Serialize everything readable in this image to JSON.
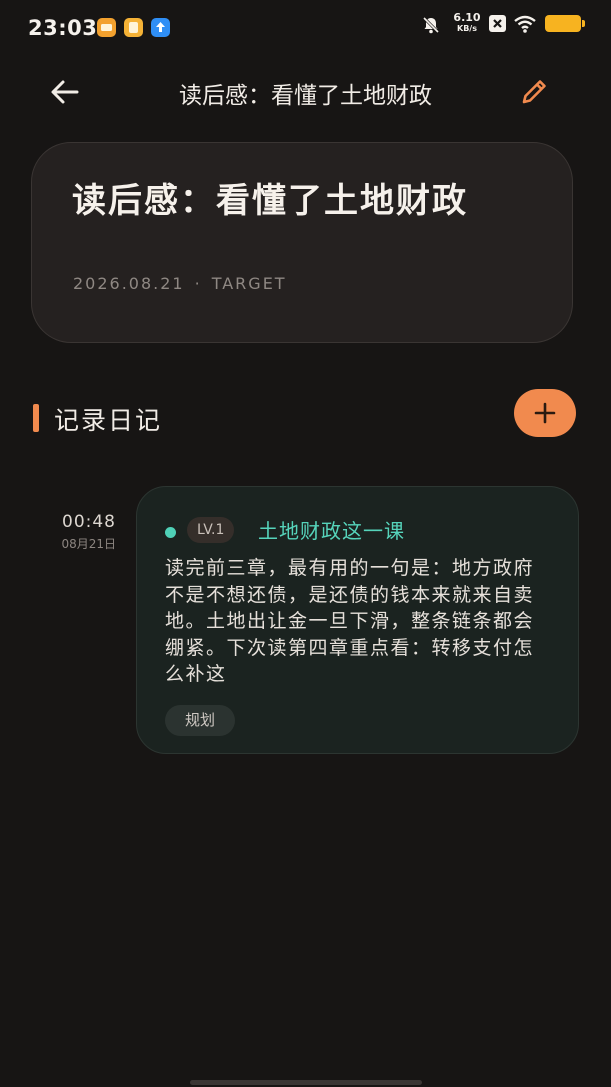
{
  "status_bar": {
    "time": "23:03",
    "net_speed_value": "6.10",
    "net_speed_unit": "KB/s",
    "battery_color": "#f7b320"
  },
  "app_bar": {
    "title": "读后感：看懂了土地财政",
    "back_icon": "arrow-left-icon",
    "edit_icon": "pencil-icon"
  },
  "book": {
    "title": "读后感：看懂了土地财政",
    "date": "2026.08.21",
    "separator": "·",
    "label": "TARGET"
  },
  "section": {
    "title": "记录日记",
    "add_icon": "plus-icon",
    "accent_color": "#f18a4e"
  },
  "entries": [
    {
      "time": "00:48",
      "date": "08月21日",
      "level": "LV.1",
      "title": "土地财政这一课",
      "body": "读完前三章，最有用的一句是：地方政府不是不想还债，是还债的钱本来就来自卖地。土地出让金一旦下滑，整条链条都会绷紧。下次读第四章重点看：转移支付怎么补这",
      "tag": "规划",
      "accent_color": "#4fd1b7"
    }
  ]
}
